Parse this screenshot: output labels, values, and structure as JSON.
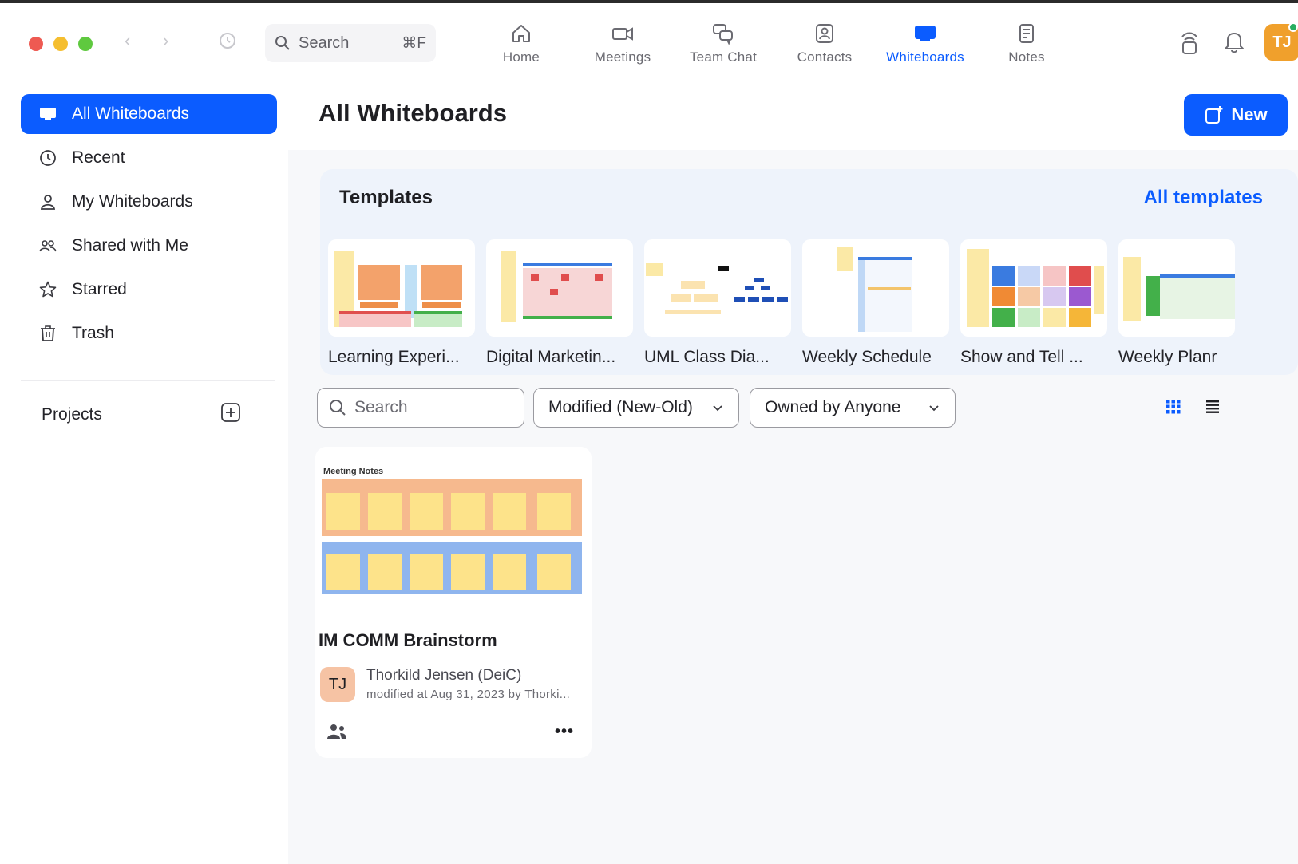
{
  "topbar": {
    "search_placeholder": "Search",
    "search_shortcut": "⌘F",
    "tabs": [
      {
        "label": "Home",
        "icon": "home-icon",
        "active": false
      },
      {
        "label": "Meetings",
        "icon": "video-camera-icon",
        "active": false
      },
      {
        "label": "Team Chat",
        "icon": "chat-bubbles-icon",
        "active": false
      },
      {
        "label": "Contacts",
        "icon": "contact-card-icon",
        "active": false
      },
      {
        "label": "Whiteboards",
        "icon": "whiteboard-icon",
        "active": true
      },
      {
        "label": "Notes",
        "icon": "notes-icon",
        "active": false
      }
    ],
    "avatar_initials": "TJ"
  },
  "sidebar": {
    "items": [
      {
        "label": "All Whiteboards",
        "icon": "whiteboard-icon",
        "active": true
      },
      {
        "label": "Recent",
        "icon": "clock-icon",
        "active": false
      },
      {
        "label": "My Whiteboards",
        "icon": "person-icon",
        "active": false
      },
      {
        "label": "Shared with Me",
        "icon": "people-icon",
        "active": false
      },
      {
        "label": "Starred",
        "icon": "star-icon",
        "active": false
      },
      {
        "label": "Trash",
        "icon": "trash-icon",
        "active": false
      }
    ],
    "projects_label": "Projects"
  },
  "main": {
    "title": "All Whiteboards",
    "new_button": "New",
    "templates": {
      "title": "Templates",
      "all_link": "All templates",
      "items": [
        {
          "name": "Learning Experi..."
        },
        {
          "name": "Digital Marketin..."
        },
        {
          "name": "UML Class Dia..."
        },
        {
          "name": "Weekly Schedule"
        },
        {
          "name": "Show and Tell ..."
        },
        {
          "name": "Weekly Planr"
        }
      ]
    },
    "filters": {
      "search_placeholder": "Search",
      "sort": "Modified (New-Old)",
      "owner": "Owned by Anyone"
    },
    "whiteboards": [
      {
        "thumb_heading": "Meeting Notes",
        "title": "IM COMM Brainstorm",
        "owner_initials": "TJ",
        "owner": "Thorkild Jensen (DeiC)",
        "modified": "modified at Aug 31, 2023 by Thorki..."
      }
    ]
  },
  "colors": {
    "accent": "#0b5cff",
    "avatar": "#f0a02c",
    "sticky": "#fde38a",
    "orange_band": "#f6b98e",
    "blue_band": "#8fb5ee"
  }
}
